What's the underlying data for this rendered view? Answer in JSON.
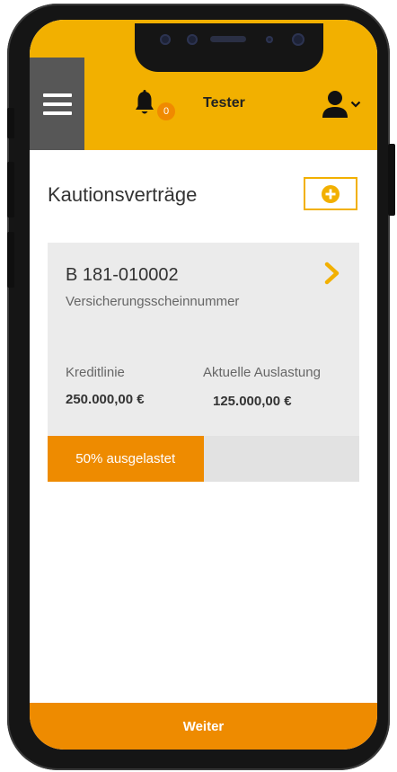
{
  "header": {
    "notification_count": "0",
    "user_name": "Tester"
  },
  "main": {
    "title": "Kautionsverträge"
  },
  "card": {
    "contract_number": "B 181-010002",
    "contract_label": "Versicherungsscheinnummer",
    "credit_line_label": "Kreditlinie",
    "credit_line_value": "250.000,00 €",
    "utilization_label": "Aktuelle Auslastung",
    "utilization_value": "125.000,00 €",
    "progress_text": "50% ausgelastet",
    "progress_fraction": 0.5
  },
  "footer": {
    "next_label": "Weiter"
  },
  "colors": {
    "primary_yellow": "#f2b000",
    "accent_orange": "#ee8b00",
    "menu_gray": "#575757",
    "card_gray": "#ebebeb"
  },
  "icons": {
    "menu": "hamburger-icon",
    "notifications": "bell-icon",
    "user": "user-icon",
    "add": "plus-circle-icon",
    "open": "chevron-right-icon"
  }
}
